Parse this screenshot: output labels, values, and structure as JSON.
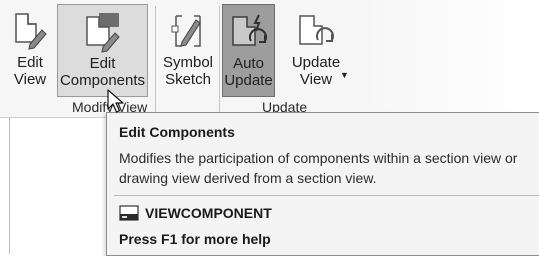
{
  "ribbon": {
    "buttons": [
      {
        "line1": "Edit",
        "line2": "View",
        "icon": "edit-view-icon"
      },
      {
        "line1": "Edit",
        "line2": "Components",
        "icon": "edit-components-icon"
      },
      {
        "line1": "Symbol",
        "line2": "Sketch",
        "icon": "symbol-sketch-icon"
      },
      {
        "line1": "Auto",
        "line2": "Update",
        "icon": "auto-update-icon"
      },
      {
        "line1": "Update",
        "line2": "View",
        "icon": "update-view-icon"
      }
    ],
    "panels": {
      "modify": "Modify View",
      "update": "Update"
    }
  },
  "tooltip": {
    "title": "Edit Components",
    "description": "Modifies the participation of components within a section view or drawing view derived from a section view.",
    "command": "VIEWCOMPONENT",
    "help": "Press F1 for more help"
  }
}
